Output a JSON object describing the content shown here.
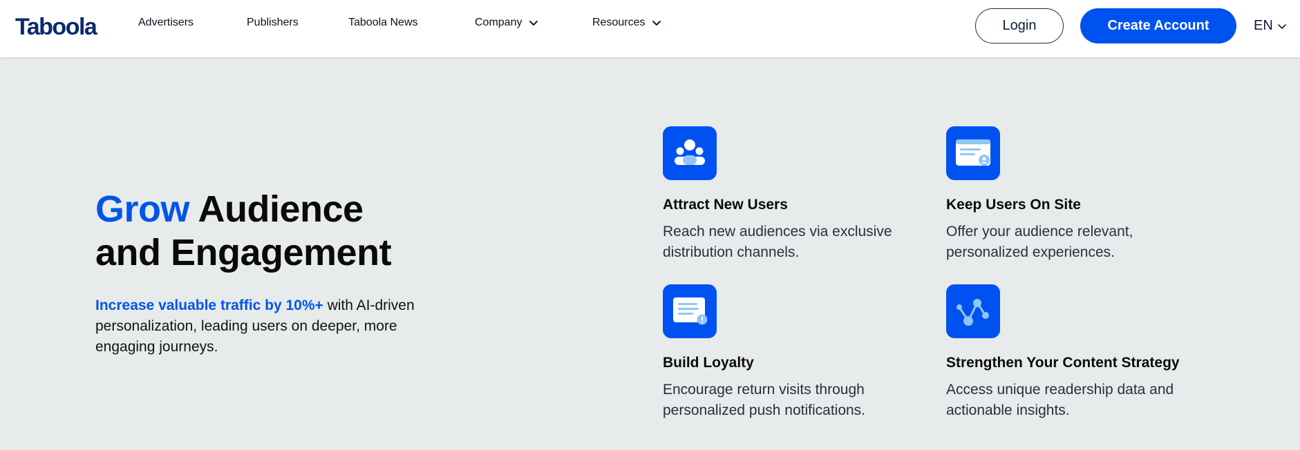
{
  "header": {
    "logo_text": "Taboola",
    "nav": [
      {
        "label": "Advertisers"
      },
      {
        "label": "Publishers"
      },
      {
        "label": "Taboola News"
      },
      {
        "label": "Company"
      },
      {
        "label": "Resources"
      }
    ],
    "login_label": "Login",
    "create_account_label": "Create Account",
    "language": "EN"
  },
  "hero": {
    "title_accent": "Grow",
    "title_rest_line1": " Audience",
    "title_line2": "and Engagement",
    "desc_highlight": "Increase valuable traffic by 10%+",
    "desc_rest": " with AI-driven personalization, leading users on deeper, more engaging journeys."
  },
  "features": [
    {
      "icon": "users-group-icon",
      "title": "Attract New Users",
      "desc": "Reach new audiences via exclusive distribution channels."
    },
    {
      "icon": "browser-window-icon",
      "title": "Keep Users On Site",
      "desc": "Offer your audience relevant, personalized experiences."
    },
    {
      "icon": "notification-card-icon",
      "title": "Build Loyalty",
      "desc": "Encourage return visits through personalized push notifications."
    },
    {
      "icon": "data-graph-icon",
      "title": "Strengthen Your Content Strategy",
      "desc": "Access unique readership data and actionable insights."
    }
  ],
  "colors": {
    "brand_blue": "#0052f0",
    "accent_text": "#0055e8",
    "logo_navy": "#0b2a6f",
    "background": "#e8ebec"
  }
}
